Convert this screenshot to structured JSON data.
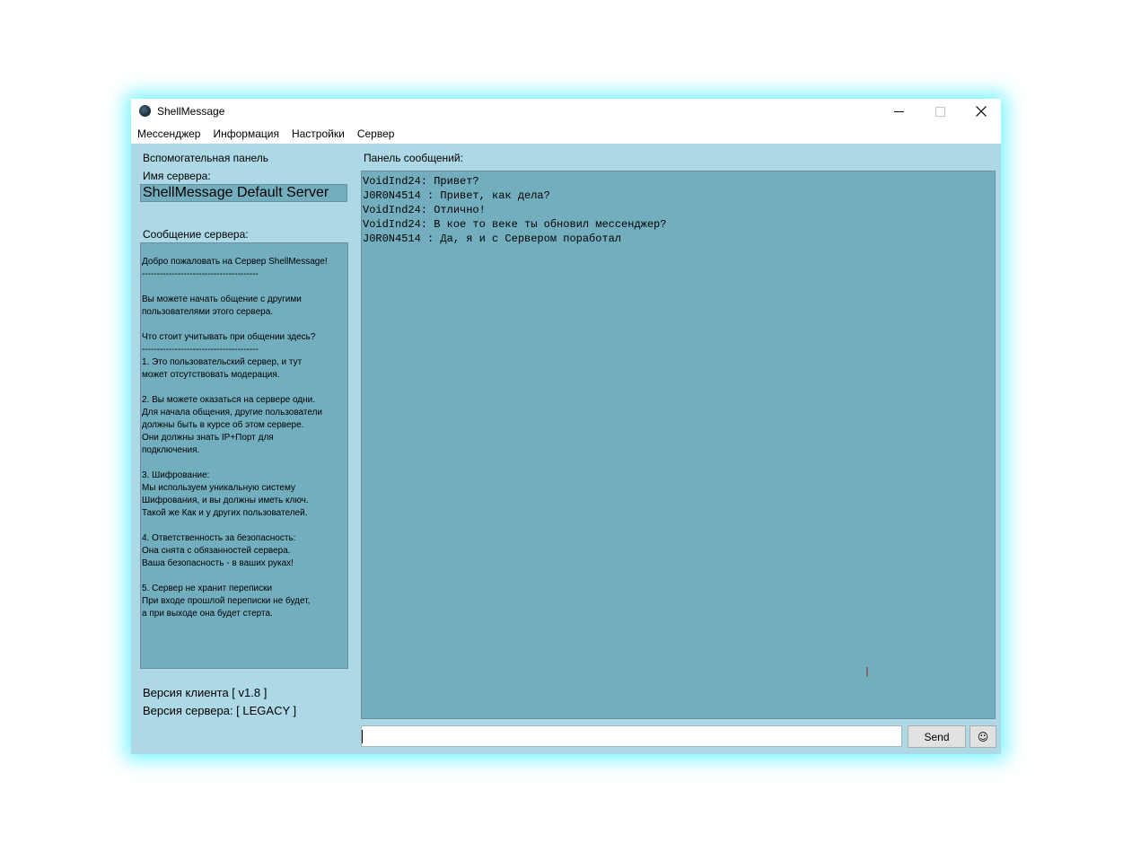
{
  "window": {
    "title": "ShellMessage",
    "icon": "app-icon",
    "controls": {
      "minimize": "—",
      "maximize": "☐",
      "close": "✕"
    }
  },
  "menu": {
    "items": [
      "Мессенджер",
      "Информация",
      "Настройки",
      "Сервер"
    ]
  },
  "side_panel": {
    "title": "Вспомогательная панель",
    "server_name_label": "Имя сервера:",
    "server_name_value": "ShellMessage Default Server",
    "server_message_label": "Сообщение сервера:",
    "server_message_lines": [
      "",
      "Добро пожаловать на Сервер ShellMessage!",
      "---------------------------------------",
      "",
      "Вы можете начать общение с другими",
      "пользователями этого сервера.",
      "",
      "Что стоит учитывать при общении здесь?",
      "---------------------------------------",
      "1. Это пользовательский сервер, и тут",
      "может отсутствовать модерация.",
      "",
      "2. Вы можете оказаться на сервере одни.",
      "Для начала общения, другие пользователи",
      "должны быть в курсе об этом сервере.",
      "Они должны знать IP+Порт для",
      "подключения.",
      "",
      "3. Шифрование:",
      "Мы используем уникальную систему",
      "Шифрования, и вы должны иметь ключ.",
      "Такой же Как и у других пользователей.",
      "",
      "4. Ответственность за безопасность:",
      "Она снята с обязанностей сервера.",
      "Ваша безопасность - в ваших руках!",
      "",
      "5. Сервер не хранит переписки",
      "При входе прошлой переписки не будет,",
      "а при выходе она будет стерта."
    ],
    "client_version": "Версия клиента [ v1.8 ]",
    "server_version": "Версия сервера: [ LEGACY ]"
  },
  "message_panel": {
    "title": "Панель сообщений:",
    "messages": [
      "VoidInd24: Привет?",
      "J0R0N4514 : Привет, как дела?",
      "VoidInd24: Отлично!",
      "VoidInd24: В кое то веке ты обновил мессенджер?",
      "J0R0N4514 : Да, я и с Сервером поработал"
    ]
  },
  "input": {
    "value": "",
    "placeholder": ""
  },
  "buttons": {
    "send_label": "Send",
    "emoji_label": "☺"
  },
  "colors": {
    "window_bg": "#add8e6",
    "panel_bg": "#73aebf",
    "glow": "#00ebff"
  }
}
